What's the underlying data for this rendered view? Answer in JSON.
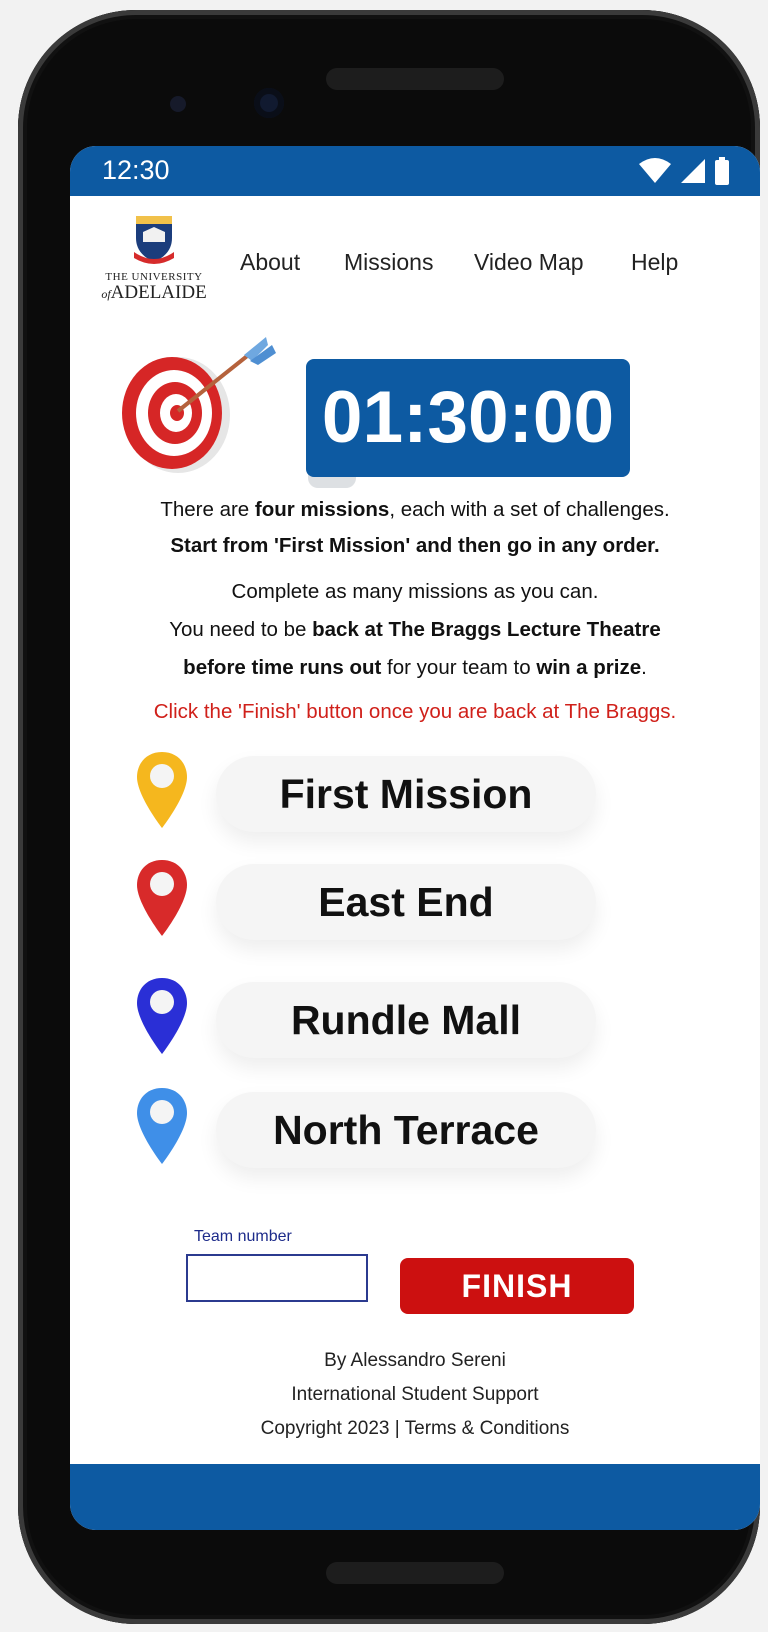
{
  "status_bar": {
    "time": "12:30"
  },
  "logo": {
    "line1": "THE UNIVERSITY",
    "line2_prefix": "of",
    "line2": "ADELAIDE"
  },
  "nav": {
    "items": [
      "About",
      "Missions",
      "Video Map",
      "Help"
    ]
  },
  "timer": {
    "value": "01:30:00"
  },
  "intro": {
    "line1_a": "There are ",
    "line1_b": "four missions",
    "line1_c": ", each with a set of challenges.",
    "line2": "Start from 'First Mission' and then go in any order.",
    "line3": "Complete as many missions as you can.",
    "line4_a": "You need to be ",
    "line4_b": "back at The Braggs Lecture Theatre",
    "line5_a": "before time runs out",
    "line5_b": " for your team to ",
    "line5_c": "win a prize",
    "line5_d": ".",
    "notice": "Click the 'Finish' button once you are back at The Braggs."
  },
  "missions": [
    {
      "label": "First Mission",
      "pin_color": "#f5b71e"
    },
    {
      "label": "East End",
      "pin_color": "#d82a2a"
    },
    {
      "label": "Rundle Mall",
      "pin_color": "#2a2fd6"
    },
    {
      "label": "North Terrace",
      "pin_color": "#3f8fe8"
    }
  ],
  "team": {
    "label": "Team number",
    "value": ""
  },
  "finish_button": {
    "label": "FINISH"
  },
  "footer": {
    "line1": "By Alessandro Sereni",
    "line2": "International Student Support",
    "line3": "Copyright 2023 | Terms & Conditions"
  },
  "colors": {
    "primary": "#0d5aa2",
    "finish": "#cc1010",
    "notice": "#d0201a"
  }
}
